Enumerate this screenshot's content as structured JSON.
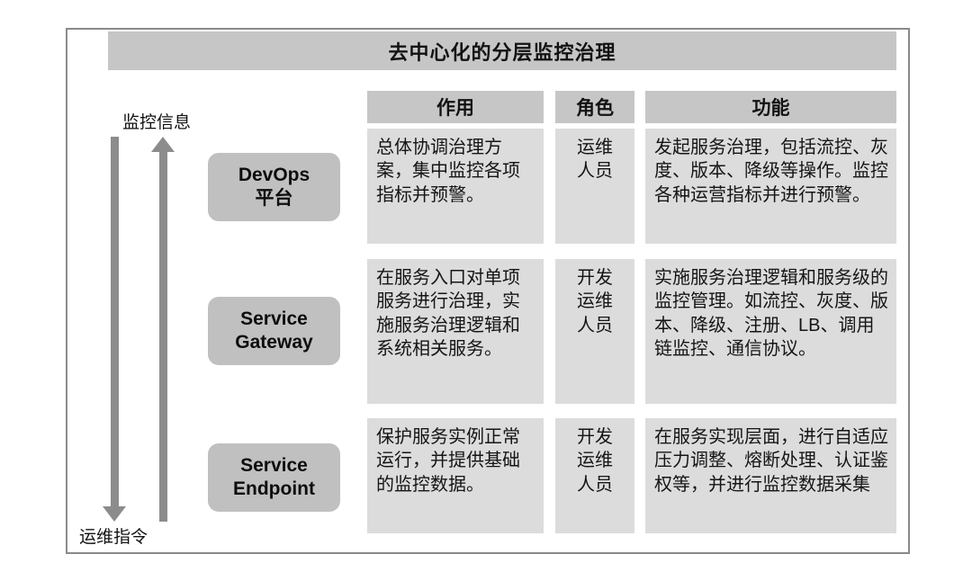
{
  "diagram": {
    "title": "去中心化的分层监控治理",
    "flows": [
      {
        "id": "monitor-info",
        "label": "监控信息",
        "direction": "up"
      },
      {
        "id": "ops-command",
        "label": "运维指令",
        "direction": "down"
      }
    ],
    "columns": {
      "node": "",
      "role": "作用",
      "actor": "角色",
      "function": "功能"
    },
    "rows": [
      {
        "node": {
          "line1": "DevOps",
          "line2": "平台"
        },
        "role": "总体协调治理方案，集中监控各项指标并预警。",
        "actor": "运维\n人员",
        "function": "发起服务治理，包括流控、灰度、版本、降级等操作。监控各种运营指标并进行预警。"
      },
      {
        "node": {
          "line1": "Service",
          "line2": "Gateway"
        },
        "role": "在服务入口对单项服务进行治理，实施服务治理逻辑和系统相关服务。",
        "actor": "开发\n运维\n人员",
        "function": "实施服务治理逻辑和服务级的监控管理。如流控、灰度、版本、降级、注册、LB、调用链监控、通信协议。"
      },
      {
        "node": {
          "line1": "Service",
          "line2": "Endpoint"
        },
        "role": "保护服务实例正常运行，并提供基础的监控数据。",
        "actor": "开发\n运维\n人员",
        "function": "在服务实现层面，进行自适应压力调整、熔断处理、认证鉴权等，并进行监控数据采集"
      }
    ],
    "colors": {
      "header_gray": "#c6c6c6",
      "cell_gray": "#dcdcdc",
      "pill_gray": "#c0c0c0",
      "arrow_gray": "#8c8c8c",
      "frame_border": "#8a8a8a",
      "text": "#121212",
      "background": "#ffffff"
    }
  }
}
